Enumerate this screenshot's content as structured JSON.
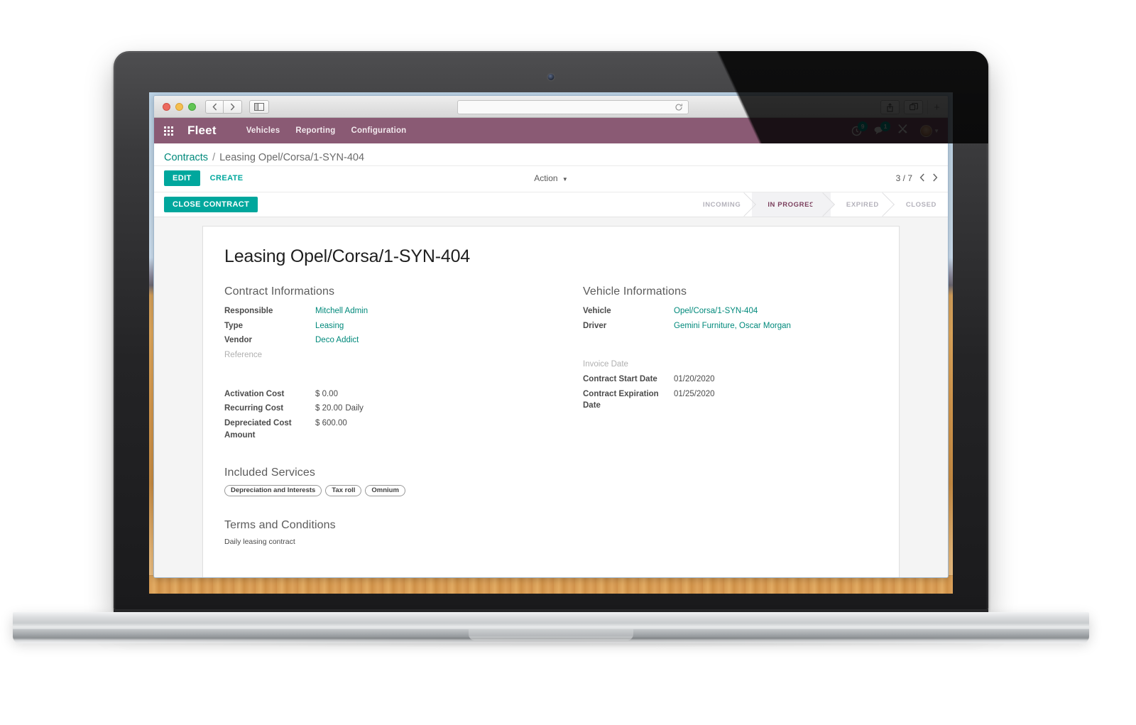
{
  "browser": {
    "back_icon": "chevron-left-icon",
    "forward_icon": "chevron-right-icon",
    "sidebar_icon": "sidebar-toggle-icon",
    "address_value": "",
    "address_placeholder": "",
    "reload_icon": "reload-icon",
    "share_icon": "share-icon",
    "tabs_icon": "show-tabs-icon",
    "new_tab_label": "+"
  },
  "topbar": {
    "apps_icon": "apps-grid-icon",
    "brand": "Fleet",
    "menu": [
      {
        "label": "Vehicles"
      },
      {
        "label": "Reporting"
      },
      {
        "label": "Configuration"
      }
    ],
    "activities": {
      "icon": "clock-icon",
      "count": "9"
    },
    "messages": {
      "icon": "chat-icon",
      "count": "1"
    },
    "debug": {
      "icon": "tools-icon"
    },
    "user": {
      "icon": "avatar-icon",
      "caret": "caret-down-icon"
    },
    "bg_color": "#8a5a74"
  },
  "breadcrumb": {
    "root": "Contracts",
    "separator": "/",
    "current": "Leasing Opel/Corsa/1-SYN-404"
  },
  "control_panel": {
    "edit_label": "EDIT",
    "create_label": "CREATE",
    "action_label": "Action",
    "action_caret": "caret-down-icon",
    "pager_text": "3 / 7",
    "prev_icon": "chevron-left-icon",
    "next_icon": "chevron-right-icon"
  },
  "statusbar": {
    "close_contract_label": "CLOSE CONTRACT",
    "stages": [
      {
        "label": "INCOMING",
        "active": false
      },
      {
        "label": "IN PROGRESS",
        "active": true
      },
      {
        "label": "EXPIRED",
        "active": false
      },
      {
        "label": "CLOSED",
        "active": false
      }
    ],
    "active_color": "#7b3f5d"
  },
  "form": {
    "title": "Leasing Opel/Corsa/1-SYN-404",
    "contract_group": {
      "title": "Contract Informations",
      "fields": [
        {
          "label": "Responsible",
          "value": "Mitchell Admin",
          "link": true
        },
        {
          "label": "Type",
          "value": "Leasing",
          "link": true
        },
        {
          "label": "Vendor",
          "value": "Deco Addict",
          "link": true
        },
        {
          "label": "Reference",
          "value": "",
          "link": false,
          "muted_label": true
        }
      ],
      "cost_fields": [
        {
          "label": "Activation Cost",
          "value": "$ 0.00",
          "suffix": ""
        },
        {
          "label": "Recurring Cost",
          "value": "$ 20.00",
          "suffix": "Daily"
        },
        {
          "label": "Depreciated Cost Amount",
          "value": "$ 600.00",
          "suffix": ""
        }
      ]
    },
    "vehicle_group": {
      "title": "Vehicle Informations",
      "fields": [
        {
          "label": "Vehicle",
          "value": "Opel/Corsa/1-SYN-404",
          "link": true
        },
        {
          "label": "Driver",
          "value": "Gemini Furniture, Oscar Morgan",
          "link": true
        }
      ],
      "date_fields": [
        {
          "label": "Invoice Date",
          "value": "",
          "muted_label": true
        },
        {
          "label": "Contract Start Date",
          "value": "01/20/2020",
          "muted_label": false
        },
        {
          "label": "Contract Expiration Date",
          "value": "01/25/2020",
          "muted_label": false
        }
      ]
    },
    "services": {
      "title": "Included Services",
      "tags": [
        "Depreciation and Interests",
        "Tax roll",
        "Omnium"
      ]
    },
    "terms": {
      "title": "Terms and Conditions",
      "text": "Daily leasing contract"
    }
  },
  "colors": {
    "accent_teal": "#00a79d",
    "link_teal": "#00897b",
    "topbar_purple": "#8a5a74"
  }
}
